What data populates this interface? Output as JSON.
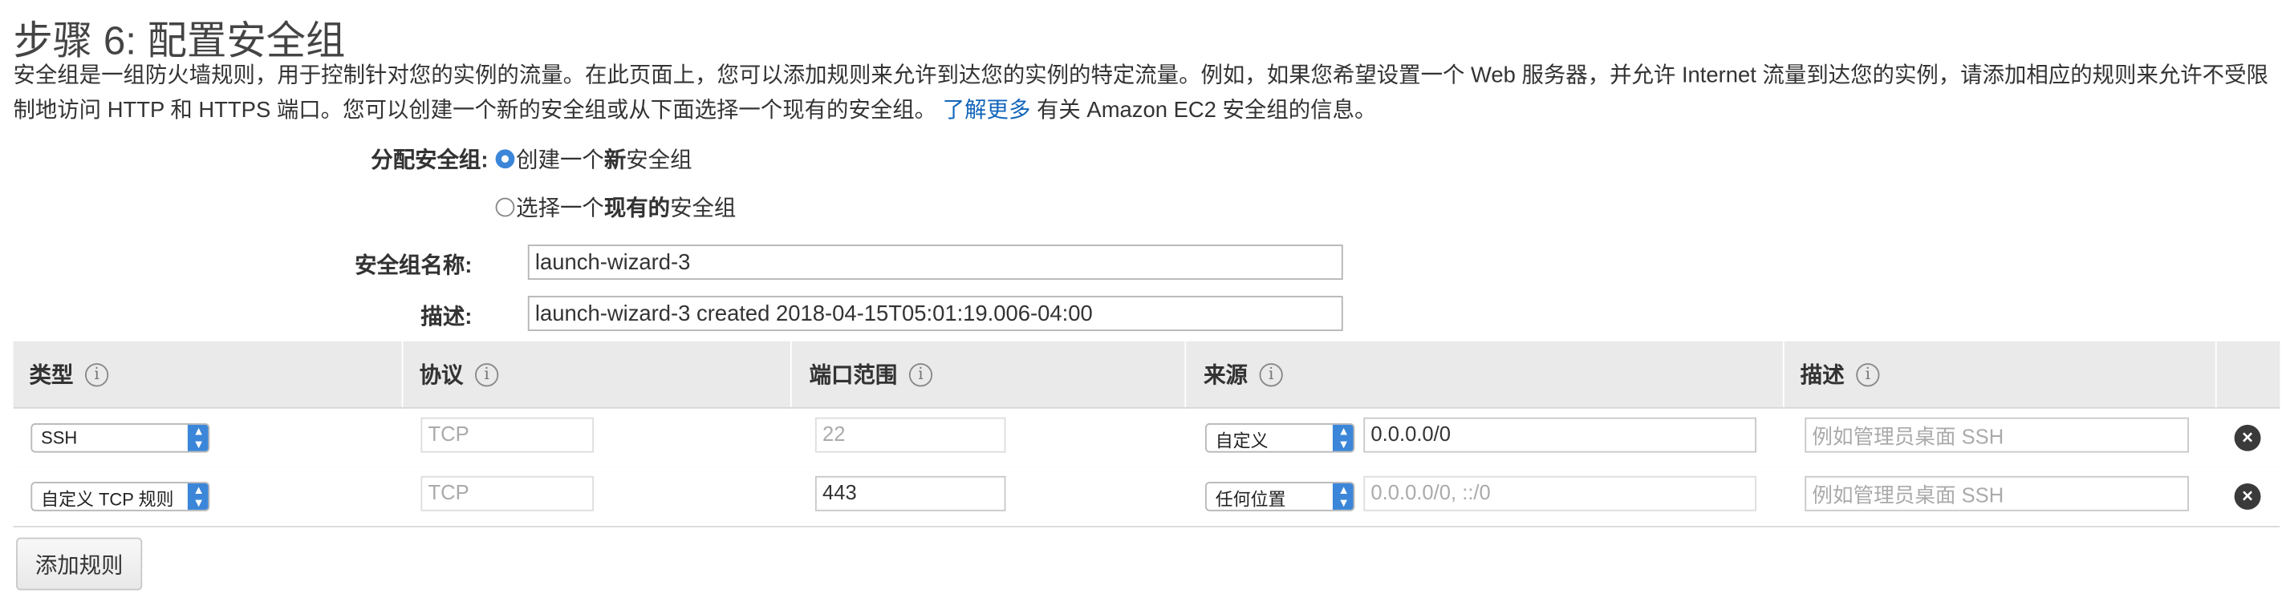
{
  "page": {
    "title": "步骤 6: 配置安全组",
    "description_text": "安全组是一组防火墙规则，用于控制针对您的实例的流量。在此页面上，您可以添加规则来允许到达您的实例的特定流量。例如，如果您希望设置一个 Web 服务器，并允许 Internet 流量到达您的实例，请添加相应的规则来允许不受限制地访问 HTTP 和 HTTPS 端口。您可以创建一个新的安全组或从下面选择一个现有的安全组。",
    "learn_more_link": "了解更多",
    "description_tail": "有关 Amazon EC2 安全组的信息。"
  },
  "assign": {
    "label": "分配安全组:",
    "option_new_prefix": "创建一个",
    "option_new_bold": "新",
    "option_new_suffix": "安全组",
    "option_existing_prefix": "选择一个",
    "option_existing_bold": "现有的",
    "option_existing_suffix": "安全组",
    "selected": "new"
  },
  "form": {
    "name_label": "安全组名称:",
    "name_value": "launch-wizard-3",
    "desc_label": "描述:",
    "desc_value": "launch-wizard-3 created 2018-04-15T05:01:19.006-04:00"
  },
  "table": {
    "headers": [
      "类型",
      "协议",
      "端口范围",
      "来源",
      "描述"
    ],
    "info_icon": "i",
    "rows": [
      {
        "type": "SSH",
        "protocol": "TCP",
        "port": "22",
        "source_select": "自定义",
        "source_value": "0.0.0.0/0",
        "description_placeholder": "例如管理员桌面 SSH"
      },
      {
        "type": "自定义 TCP 规则",
        "protocol": "TCP",
        "port": "443",
        "source_select": "任何位置",
        "source_value": "0.0.0.0/0, ::/0",
        "description_placeholder": "例如管理员桌面 SSH"
      }
    ]
  },
  "add_rule_button": "添加规则",
  "colors": {
    "link": "#1166bb",
    "radio_selected": "#3b86d8",
    "header_bg": "#eaeaea",
    "select_arrow": "#3b86d8"
  }
}
